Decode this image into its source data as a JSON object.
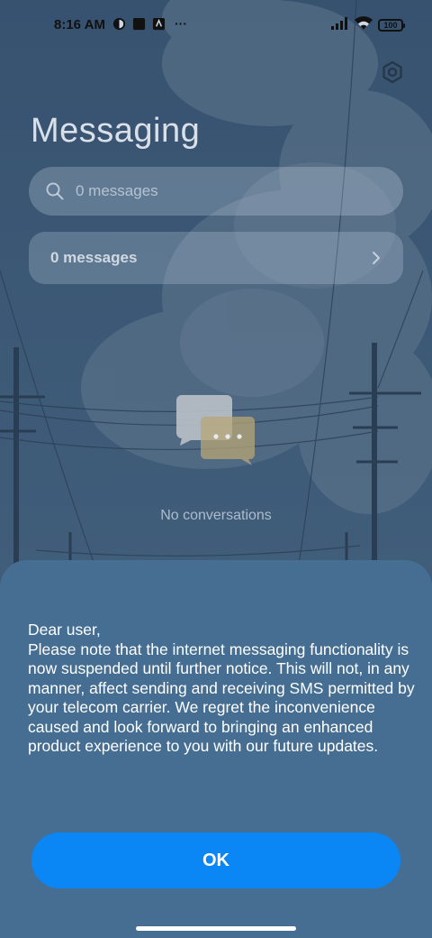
{
  "status_bar": {
    "time": "8:16 AM",
    "battery": "100",
    "overflow": "···"
  },
  "header": {
    "title": "Messaging",
    "settings_icon": "gear-icon"
  },
  "search": {
    "placeholder": "0 messages",
    "icon": "search-icon"
  },
  "summary": {
    "label": "0 messages"
  },
  "empty_state": {
    "text": "No conversations"
  },
  "dialog": {
    "lines": [
      "Dear user,",
      "Please note that the internet messaging functionality is now suspended until further notice. This will not, in any manner, affect sending and receiving SMS permitted by your telecom carrier. We regret the inconvenience caused and look forward to bringing an enhanced product experience to you with our future updates."
    ],
    "ok_label": "OK"
  },
  "colors": {
    "accent": "#0a86f5",
    "sheet": "#456e92"
  }
}
